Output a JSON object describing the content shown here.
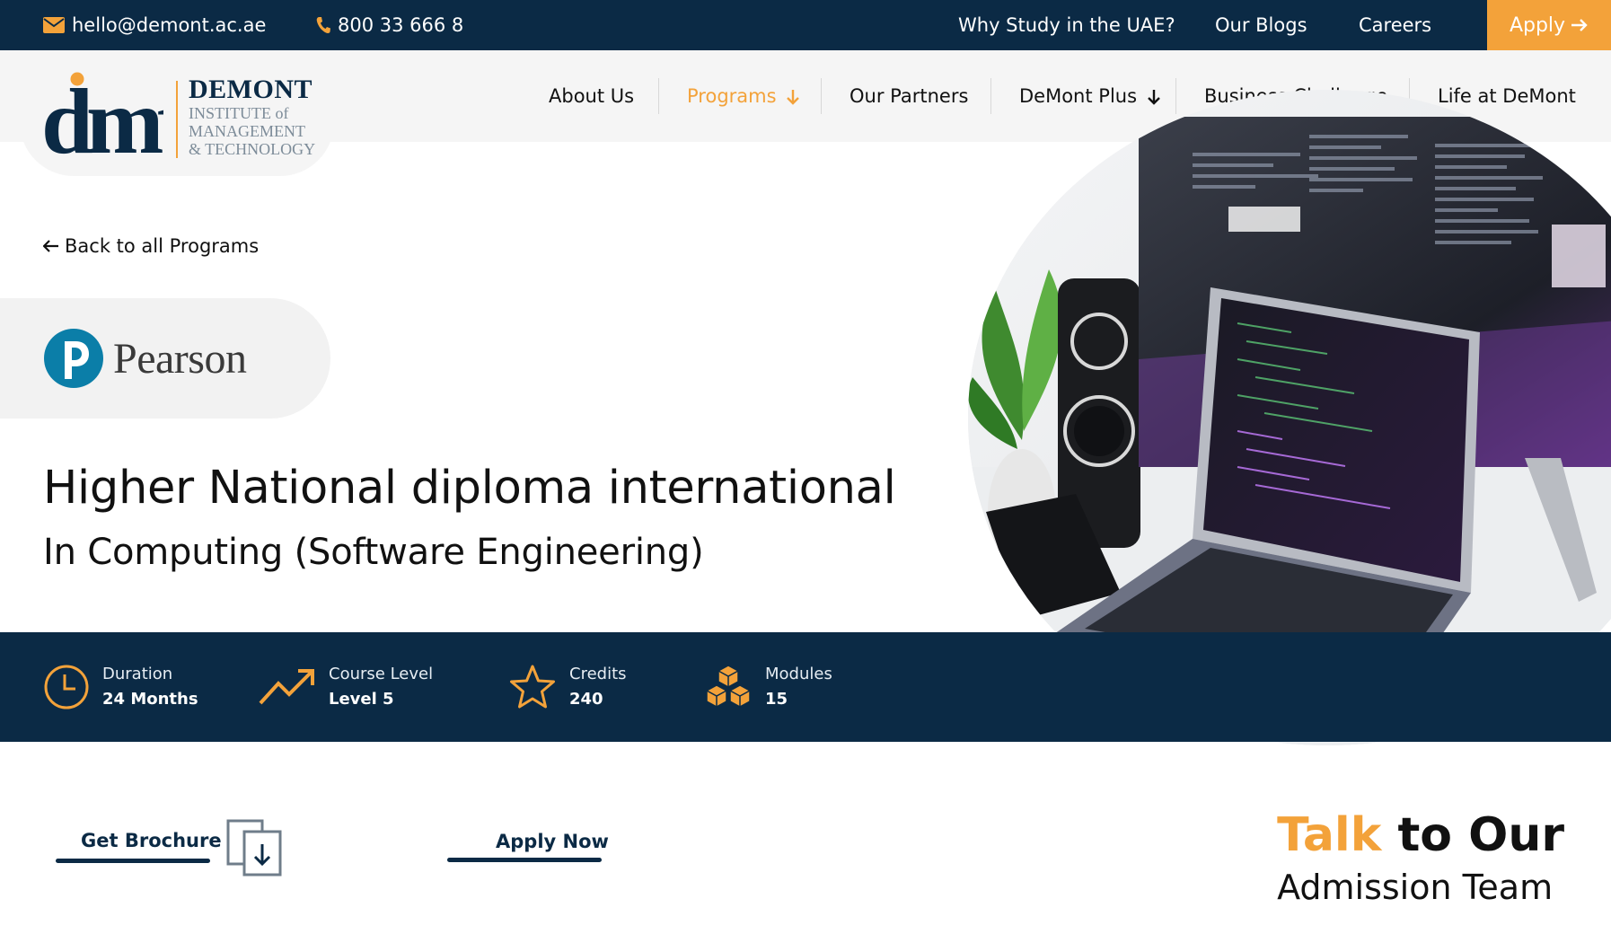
{
  "topbar": {
    "email": "hello@demont.ac.ae",
    "phone": "800 33 666 8",
    "links": [
      "Why Study in the UAE?",
      "Our Blogs",
      "Careers"
    ],
    "apply_label": "Apply"
  },
  "logo": {
    "mark": "dmt",
    "brand": "DEMONT",
    "line1": "INSTITUTE of",
    "line2": "MANAGEMENT",
    "line3": "& TECHNOLOGY"
  },
  "nav": {
    "items": [
      {
        "label": "About Us",
        "dropdown": false
      },
      {
        "label": "Programs",
        "dropdown": true,
        "active": true
      },
      {
        "label": "Our Partners",
        "dropdown": false
      },
      {
        "label": "DeMont Plus",
        "dropdown": true
      },
      {
        "label": "Business Challenge",
        "dropdown": false
      },
      {
        "label": "Life at DeMont",
        "dropdown": false
      }
    ]
  },
  "hero": {
    "back_label": "Back to all Programs",
    "partner": "Pearson",
    "title": "Higher National diploma international",
    "subtitle": "In Computing (Software Engineering)"
  },
  "stats": [
    {
      "icon": "clock-icon",
      "label": "Duration",
      "value": "24 Months"
    },
    {
      "icon": "trend-up-icon",
      "label": "Course Level",
      "value": "Level 5"
    },
    {
      "icon": "star-icon",
      "label": "Credits",
      "value": "240"
    },
    {
      "icon": "cubes-icon",
      "label": "Modules",
      "value": "15"
    }
  ],
  "cta": {
    "brochure_label": "Get Brochure",
    "apply_label": "Apply Now"
  },
  "talk": {
    "highlight": "Talk",
    "rest": "to Our",
    "line2": "Admission Team"
  },
  "colors": {
    "navy": "#0b2a45",
    "accent": "#f3a23a",
    "pearson_blue": "#0b7ea8"
  }
}
